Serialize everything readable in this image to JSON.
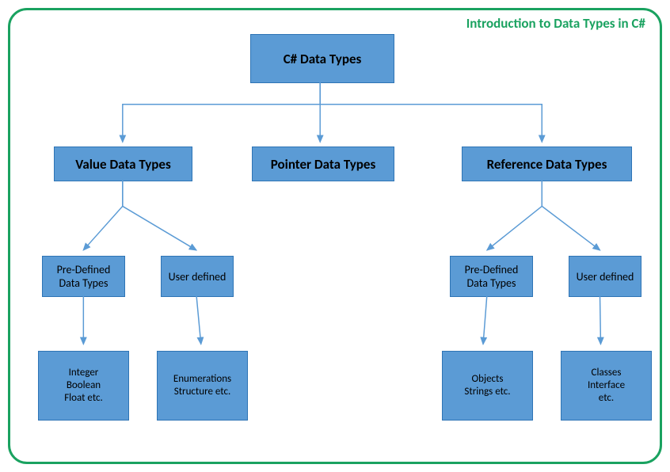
{
  "title": "Introduction to Data Types in C#",
  "root": "C# Data Types",
  "level2": {
    "value": "Value Data Types",
    "pointer": "Pointer Data Types",
    "reference": "Reference Data Types"
  },
  "value_branch": {
    "predefined_label": "Pre-Defined Data Types",
    "userdefined_label": "User defined",
    "predefined_examples": "Integer\nBoolean\nFloat etc.",
    "userdefined_examples": "Enumerations\nStructure etc."
  },
  "reference_branch": {
    "predefined_label": "Pre-Defined Data Types",
    "userdefined_label": "User defined",
    "predefined_examples": "Objects\nStrings etc.",
    "userdefined_examples": "Classes\nInterface\netc."
  },
  "chart_data": {
    "type": "tree",
    "nodes": [
      {
        "id": "root",
        "label": "C# Data Types"
      },
      {
        "id": "value",
        "label": "Value Data Types",
        "parent": "root"
      },
      {
        "id": "pointer",
        "label": "Pointer Data Types",
        "parent": "root"
      },
      {
        "id": "reference",
        "label": "Reference Data Types",
        "parent": "root"
      },
      {
        "id": "v_pre",
        "label": "Pre-Defined Data Types",
        "parent": "value"
      },
      {
        "id": "v_user",
        "label": "User defined",
        "parent": "value"
      },
      {
        "id": "v_pre_ex",
        "label": "Integer Boolean Float etc.",
        "parent": "v_pre"
      },
      {
        "id": "v_user_ex",
        "label": "Enumerations Structure etc.",
        "parent": "v_user"
      },
      {
        "id": "r_pre",
        "label": "Pre-Defined Data Types",
        "parent": "reference"
      },
      {
        "id": "r_user",
        "label": "User defined",
        "parent": "reference"
      },
      {
        "id": "r_pre_ex",
        "label": "Objects Strings etc.",
        "parent": "r_pre"
      },
      {
        "id": "r_user_ex",
        "label": "Classes Interface etc.",
        "parent": "r_user"
      }
    ]
  }
}
